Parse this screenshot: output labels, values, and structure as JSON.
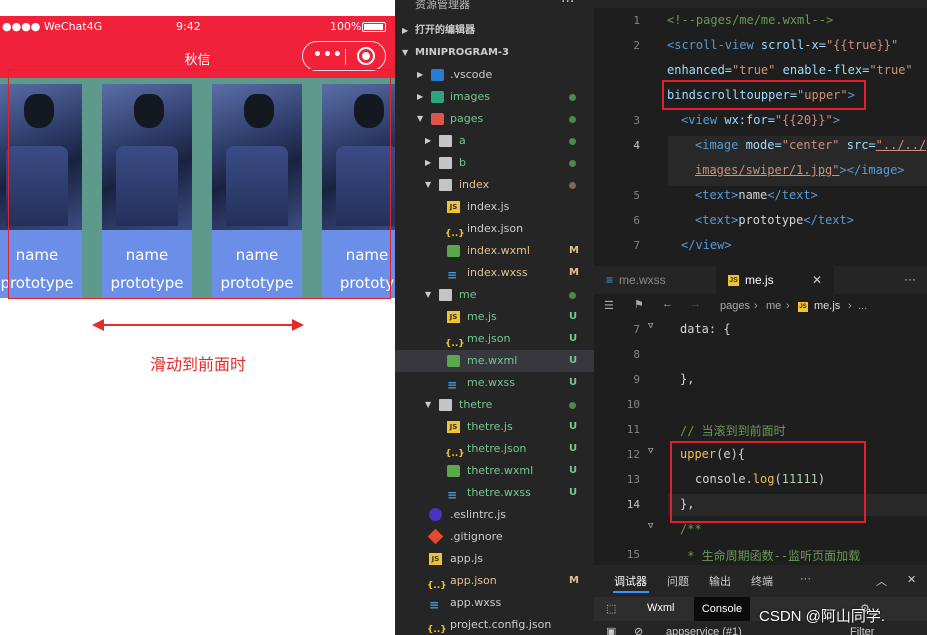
{
  "phone": {
    "carrier": "●●●● WeChat4G",
    "time": "9:42",
    "battery_pct": "100%",
    "nav_title": "秋信",
    "capsule_more": "•••",
    "cards": [
      {
        "name": "name",
        "proto": "prototype"
      },
      {
        "name": "name",
        "proto": "prototype"
      },
      {
        "name": "name",
        "proto": "prototype"
      },
      {
        "name": "name",
        "proto": "prototy"
      }
    ],
    "caption": "滑动到前面时"
  },
  "explorer": {
    "title": "资源管理器",
    "more": "···",
    "open_editors": "打开的编辑器",
    "project": "MINIPROGRAM-3",
    "items": [
      {
        "label": ".vscode",
        "status": ""
      },
      {
        "label": "images",
        "status": ""
      },
      {
        "label": "pages",
        "status": ""
      },
      {
        "label": "a",
        "status": ""
      },
      {
        "label": "b",
        "status": ""
      },
      {
        "label": "index",
        "status": ""
      },
      {
        "label": "index.js",
        "status": ""
      },
      {
        "label": "index.json",
        "status": ""
      },
      {
        "label": "index.wxml",
        "status": "M"
      },
      {
        "label": "index.wxss",
        "status": "M"
      },
      {
        "label": "me",
        "status": ""
      },
      {
        "label": "me.js",
        "status": "U"
      },
      {
        "label": "me.json",
        "status": "U"
      },
      {
        "label": "me.wxml",
        "status": "U"
      },
      {
        "label": "me.wxss",
        "status": "U"
      },
      {
        "label": "thetre",
        "status": ""
      },
      {
        "label": "thetre.js",
        "status": "U"
      },
      {
        "label": "thetre.json",
        "status": "U"
      },
      {
        "label": "thetre.wxml",
        "status": "U"
      },
      {
        "label": "thetre.wxss",
        "status": "U"
      },
      {
        "label": ".eslintrc.js",
        "status": ""
      },
      {
        "label": ".gitignore",
        "status": ""
      },
      {
        "label": "app.js",
        "status": ""
      },
      {
        "label": "app.json",
        "status": "M"
      },
      {
        "label": "app.wxss",
        "status": ""
      },
      {
        "label": "project.config.json",
        "status": ""
      }
    ]
  },
  "editor": {
    "wxml_lines": {
      "l1": "<!--pages/me/me.wxml-->",
      "l2a_tag": "<scroll-view",
      "l2a_attr": " scroll-x=",
      "l2a_val": "\"{{true}}\"",
      "l2b_attr1": "enhanced=",
      "l2b_val1": "\"true\"",
      "l2b_attr2": " enable-flex=",
      "l2b_val2": "\"true\"",
      "l2c_attr": "bindscrolltoupper=",
      "l2c_val": "\"upper\"",
      "l2c_end": ">",
      "l3_tag": "<view",
      "l3_attr": " wx:for=",
      "l3_val": "\"{{20}}\"",
      "l3_end": ">",
      "l4_tag": "<image",
      "l4_attr1": " mode=",
      "l4_val1": "\"center\"",
      "l4_attr2": " src=",
      "l4_val2": "\"../../",
      "l4b_val": "images/swiper/1.jpg\"",
      "l4b_end": "></image>",
      "l5_open": "<text>",
      "l5_txt": "name",
      "l5_close": "</text>",
      "l6_open": "<text>",
      "l6_txt": "prototype",
      "l6_close": "</text>",
      "l7": "</view>"
    },
    "line_numbers_top": [
      "1",
      "2",
      "3",
      "4",
      "5",
      "6",
      "7"
    ],
    "tab_wxss": "me.wxss",
    "tab_js": "me.js",
    "breadcrumb": [
      "pages",
      "me",
      "me.js",
      "..."
    ],
    "js_lines": {
      "data": "data: {",
      "close1": "},",
      "comment": "// 当滚到到前面时",
      "fn": "upper",
      "fn_rest": "(e){",
      "console": "console.",
      "log": "log",
      "num": "11111",
      "close2": "},",
      "doc1": "/**",
      "doc2": " * 生命周期函数--监听页面加载"
    },
    "line_numbers_bottom": [
      "7",
      "8",
      "9",
      "10",
      "11",
      "12",
      "13",
      "14",
      "15"
    ],
    "devtools": {
      "tabs": [
        "调试器",
        "问题",
        "输出",
        "终端"
      ],
      "sub_tabs": [
        "Wxml",
        "Console"
      ],
      "bottom_left": "appservice (#1)",
      "filter": "Filter"
    },
    "watermark": "CSDN @阿山同学."
  }
}
